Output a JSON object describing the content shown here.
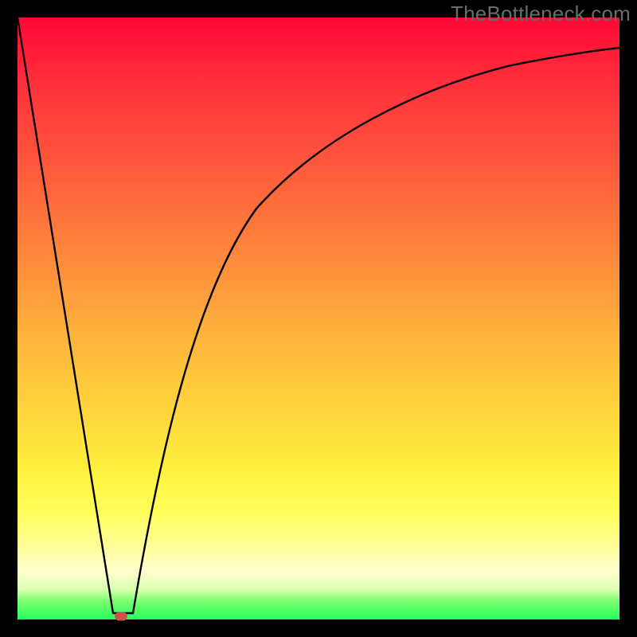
{
  "watermark": "TheBottleneck.com",
  "marker": {
    "x_frac": 0.172,
    "y_frac": 0.996,
    "color": "#cf514b"
  },
  "chart_data": {
    "type": "line",
    "title": "",
    "xlabel": "",
    "ylabel": "",
    "xlim": [
      0,
      1
    ],
    "ylim": [
      0,
      1
    ],
    "series": [
      {
        "name": "left-line",
        "x": [
          0.0,
          0.158,
          0.192
        ],
        "values": [
          1.0,
          0.01,
          0.01
        ]
      },
      {
        "name": "right-curve",
        "x": [
          0.192,
          0.22,
          0.26,
          0.3,
          0.35,
          0.4,
          0.46,
          0.52,
          0.6,
          0.7,
          0.8,
          0.9,
          1.0
        ],
        "values": [
          0.01,
          0.19,
          0.4,
          0.54,
          0.66,
          0.74,
          0.81,
          0.85,
          0.89,
          0.92,
          0.935,
          0.944,
          0.95
        ]
      }
    ],
    "annotations": [],
    "legend": false,
    "grid": false,
    "background_gradient": [
      "#ff0733",
      "#ff5a3c",
      "#ffb13c",
      "#fff03c",
      "#ffff9a",
      "#7aff6e",
      "#23ff5e"
    ]
  }
}
